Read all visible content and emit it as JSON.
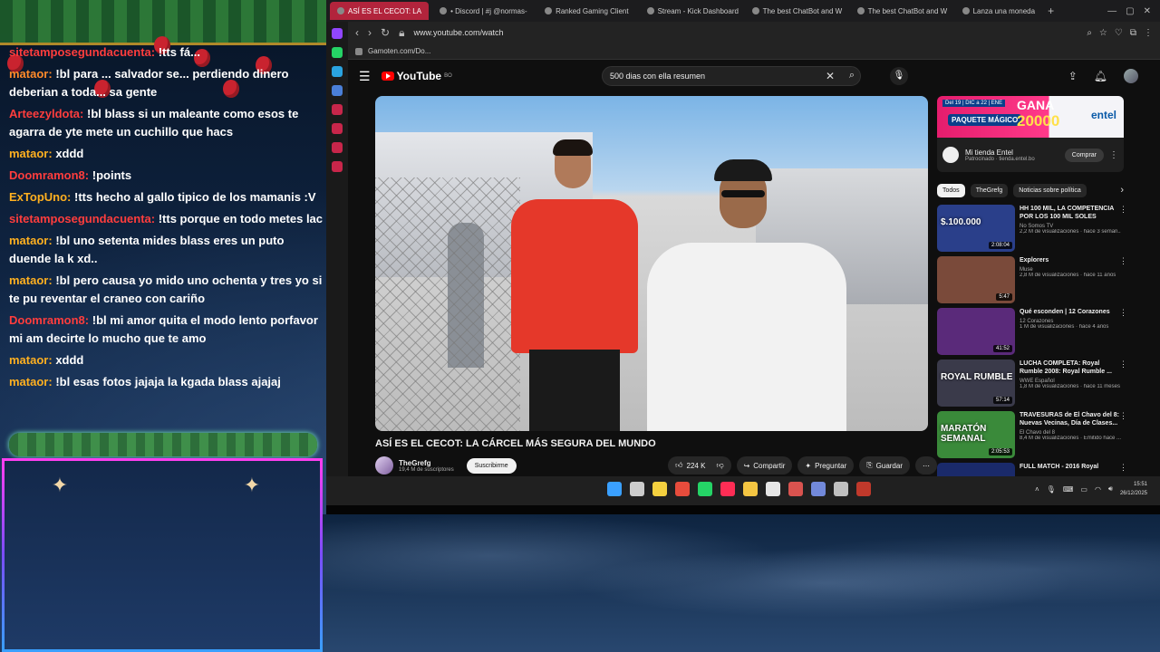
{
  "chat": {
    "lines": [
      {
        "user": "sitetamposegundacuenta:",
        "color": "#ff3d3d",
        "text": "!tts fá..."
      },
      {
        "user": "mataor:",
        "color": "#ff8a2a",
        "text": "!bl para ... salvador se... perdiendo dinero deberian a toda... sa gente",
        "wrap": true
      },
      {
        "user": "Arteezyldota:",
        "color": "#ff3d3d",
        "text": "!bl blass si un maleante como esos te agarra de yte mete un cuchillo que hacs",
        "wrap": true
      },
      {
        "user": "mataor:",
        "color": "#ffb020",
        "text": "xddd"
      },
      {
        "user": "Doomramon8:",
        "color": "#ff3d3d",
        "text": "!points"
      },
      {
        "user": "ExTopUno:",
        "color": "#ffb020",
        "text": "!tts hecho al gallo tipico de los mamanis :V"
      },
      {
        "user": "sitetamposegundacuenta:",
        "color": "#ff3d3d",
        "text": "!tts porque en todo metes lactar"
      },
      {
        "user": "mataor:",
        "color": "#ffb020",
        "text": "!bl uno setenta mides blass eres un puto duende la k xd..",
        "wrap": true
      },
      {
        "user": "mataor:",
        "color": "#ffb020",
        "text": "!bl pero causa yo mido uno ochenta y tres yo si te pu reventar el craneo con cariño",
        "wrap": true
      },
      {
        "user": "Doomramon8:",
        "color": "#ff3d3d",
        "text": "!bl mi amor quita el modo lento porfavor mi am decirte lo mucho que te amo",
        "wrap": true
      },
      {
        "user": "mataor:",
        "color": "#ffb020",
        "text": "xddd"
      },
      {
        "user": "mataor:",
        "color": "#ffb020",
        "text": "!bl esas fotos jajaja la kgada blass ajajaj"
      }
    ]
  },
  "browser": {
    "tabs": [
      {
        "label": "ASÍ ES EL CECOT: LA",
        "active": true
      },
      {
        "label": "• Discord | #j @normas-",
        "active": false
      },
      {
        "label": "Ranked Gaming Client",
        "active": false
      },
      {
        "label": "Stream - Kick Dashboard",
        "active": false
      },
      {
        "label": "The best ChatBot and W",
        "active": false
      },
      {
        "label": "The best ChatBot and W",
        "active": false
      },
      {
        "label": "Lanza una moneda",
        "active": false
      }
    ],
    "new_tab": "+",
    "url": "www.youtube.com/watch",
    "bookmark": "Gamoten.com/Do..."
  },
  "youtube": {
    "logo": "YouTube",
    "logo_region": "BO",
    "search_query": "500 dias con ella resumen",
    "video_title": "ASÍ ES EL CECOT: LA CÁRCEL MÁS SEGURA DEL MUNDO",
    "channel": {
      "name": "TheGrefg",
      "subs": "19,4 M de suscriptores"
    },
    "subscribe_label": "Suscribirme",
    "actions": {
      "likes": "224 K",
      "share": "Compartir",
      "ask": "Preguntar",
      "save": "Guardar"
    },
    "ad": {
      "tag": "Del 19 | DIC a 22 | ENE",
      "package": "PAQUETE MÁGICO",
      "gana": "GANA",
      "amount": "20000",
      "brand": "entel",
      "store_name": "Mi tienda Entel",
      "sponsored": "Patrocinado · tienda.entel.bo",
      "buy_label": "Comprar"
    },
    "chips": [
      "Todos",
      "TheGrefg",
      "Noticias sobre política"
    ],
    "recommendations": [
      {
        "title": "HH 100 MIL, LA COMPETENCIA POR LOS 100 MIL SOLES",
        "channel": "No Somos TV",
        "meta": "2,2 M de visualizaciones · hace 3 seman...",
        "duration": "2:08:04",
        "thumb_text": "$.100.000",
        "thumb_color": "#2a3f8a"
      },
      {
        "title": "Explorers",
        "channel": "Muse",
        "meta": "2,8 M de visualizaciones · hace 11 años",
        "duration": "5:47",
        "thumb_text": "",
        "thumb_color": "#7a4a3a"
      },
      {
        "title": "Qué esconden | 12 Corazones",
        "channel": "12 Corazones",
        "meta": "1 M de visualizaciones · hace 4 años",
        "duration": "41:52",
        "thumb_text": "",
        "thumb_color": "#5a2a7a"
      },
      {
        "title": "LUCHA COMPLETA: Royal Rumble 2008: Royal Rumble ...",
        "channel": "WWE Español",
        "meta": "1,8 M de visualizaciones · hace 11 meses",
        "duration": "57:14",
        "thumb_text": "ROYAL RUMBLE",
        "thumb_color": "#3a3a4a"
      },
      {
        "title": "TRAVESURAS de El Chavo del 8: Nuevas Vecinas, Día de Clases...",
        "channel": "El Chavo del 8",
        "meta": "8,4 M de visualizaciones · Emitido hace ...",
        "duration": "2:05:53",
        "thumb_text": "MARATÓN SEMANAL",
        "thumb_color": "#3a8a3a"
      },
      {
        "title": "FULL MATCH - 2016 Royal",
        "channel": "",
        "meta": "",
        "duration": "",
        "thumb_text": "",
        "thumb_color": "#1a2a6a"
      }
    ]
  },
  "taskbar": {
    "icons": [
      {
        "name": "windows-start-icon",
        "color": "#3aa0ff"
      },
      {
        "name": "search-icon",
        "color": "#cccccc"
      },
      {
        "name": "sticky-notes-icon",
        "color": "#f4d03f"
      },
      {
        "name": "chrome-icon",
        "color": "#e74c3c"
      },
      {
        "name": "whatsapp-icon",
        "color": "#25d366"
      },
      {
        "name": "opera-gx-icon",
        "color": "#ff2d55"
      },
      {
        "name": "file-explorer-icon",
        "color": "#f4c542"
      },
      {
        "name": "store-icon",
        "color": "#e6e6e6"
      },
      {
        "name": "record-icon",
        "color": "#d9534f"
      },
      {
        "name": "discord-icon",
        "color": "#7289da"
      },
      {
        "name": "obs-icon",
        "color": "#c0c0c0"
      },
      {
        "name": "app-icon",
        "color": "#c0392b"
      }
    ],
    "time": "15:51",
    "date": "26/12/2025"
  }
}
